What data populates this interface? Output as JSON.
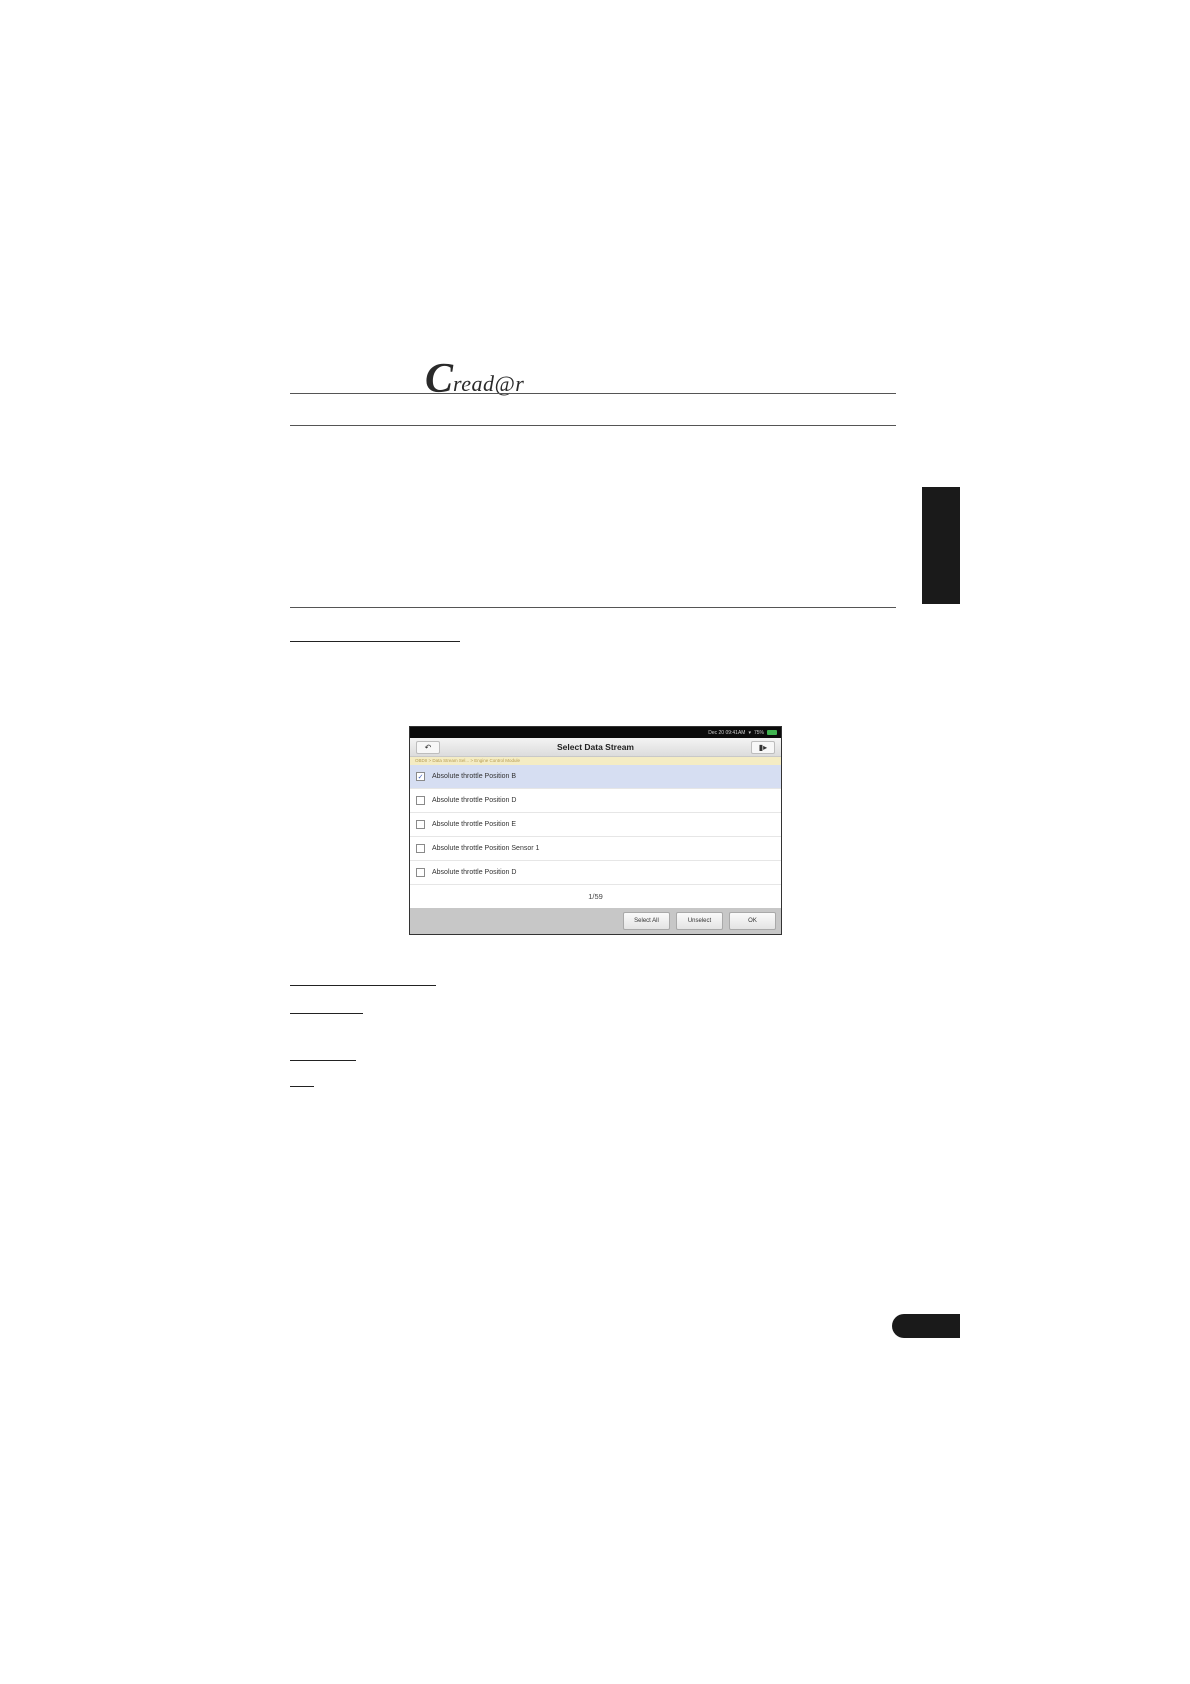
{
  "brand": {
    "logo_initial": "C",
    "logo_rest": "read@r"
  },
  "screen": {
    "status": "Dec 20 09:41AM",
    "battery": "75%",
    "title": "Select Data Stream",
    "path": "OBDII > Data Stream Sel... > Engine Control Module",
    "items": [
      {
        "label": "Absolute throttle Position B",
        "checked": true
      },
      {
        "label": "Absolute throttle Position D",
        "checked": false
      },
      {
        "label": "Absolute throttle Position E",
        "checked": false
      },
      {
        "label": "Absolute throttle Position Sensor 1",
        "checked": false
      },
      {
        "label": "Absolute throttle Position D",
        "checked": false
      }
    ],
    "page": "1/59",
    "buttons": {
      "select_all": "Select All",
      "unselect": "Unselect",
      "ok": "OK"
    },
    "check_mark": "✓"
  }
}
